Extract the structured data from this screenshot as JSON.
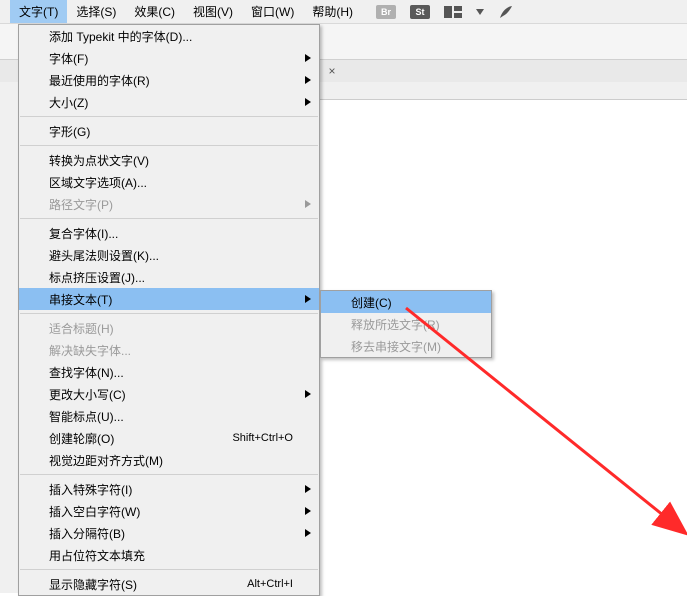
{
  "menubar": {
    "items": [
      {
        "label": "文字(T)",
        "open": true
      },
      {
        "label": "选择(S)"
      },
      {
        "label": "效果(C)"
      },
      {
        "label": "视图(V)"
      },
      {
        "label": "窗口(W)"
      },
      {
        "label": "帮助(H)"
      }
    ],
    "icons": {
      "br": "Br",
      "st": "St"
    }
  },
  "dropdown": {
    "items": [
      {
        "label": "添加 Typekit 中的字体(D)..."
      },
      {
        "label": "字体(F)",
        "submenu": true
      },
      {
        "label": "最近使用的字体(R)",
        "submenu": true
      },
      {
        "label": "大小(Z)",
        "submenu": true
      },
      {
        "sep": true
      },
      {
        "label": "字形(G)"
      },
      {
        "sep": true
      },
      {
        "label": "转换为点状文字(V)"
      },
      {
        "label": "区域文字选项(A)..."
      },
      {
        "label": "路径文字(P)",
        "submenu": true,
        "disabled": true
      },
      {
        "sep": true
      },
      {
        "label": "复合字体(I)..."
      },
      {
        "label": "避头尾法则设置(K)..."
      },
      {
        "label": "标点挤压设置(J)..."
      },
      {
        "label": "串接文本(T)",
        "submenu": true,
        "highlight": true
      },
      {
        "sep": true
      },
      {
        "label": "适合标题(H)",
        "disabled": true
      },
      {
        "label": "解决缺失字体...",
        "disabled": true
      },
      {
        "label": "查找字体(N)..."
      },
      {
        "label": "更改大小写(C)",
        "submenu": true
      },
      {
        "label": "智能标点(U)..."
      },
      {
        "label": "创建轮廓(O)",
        "shortcut": "Shift+Ctrl+O"
      },
      {
        "label": "视觉边距对齐方式(M)"
      },
      {
        "sep": true
      },
      {
        "label": "插入特殊字符(I)",
        "submenu": true
      },
      {
        "label": "插入空白字符(W)",
        "submenu": true
      },
      {
        "label": "插入分隔符(B)",
        "submenu": true
      },
      {
        "label": "用占位符文本填充"
      },
      {
        "sep": true
      },
      {
        "label": "显示隐藏字符(S)",
        "shortcut": "Alt+Ctrl+I"
      }
    ]
  },
  "submenu": {
    "items": [
      {
        "label": "创建(C)",
        "highlight": true
      },
      {
        "label": "释放所选文字(R)",
        "disabled": true
      },
      {
        "label": "移去串接文字(M)",
        "disabled": true
      }
    ]
  },
  "docbar": {
    "close_glyph": "×"
  }
}
